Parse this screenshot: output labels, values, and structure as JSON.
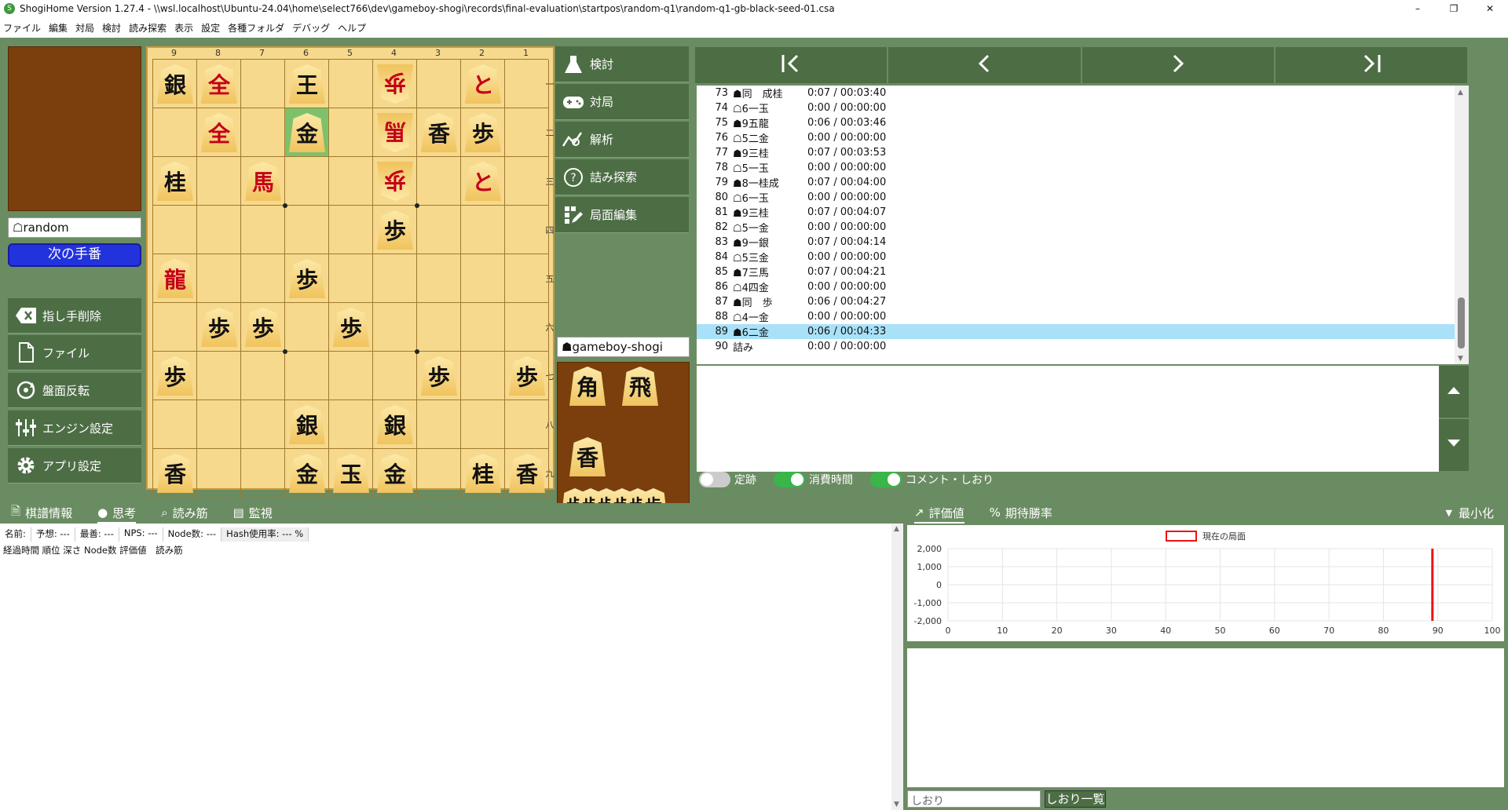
{
  "window": {
    "title": "ShogiHome Version 1.27.4 - \\\\wsl.localhost\\Ubuntu-24.04\\home\\select766\\dev\\gameboy-shogi\\records\\final-evaluation\\startpos\\random-q1\\random-q1-gb-black-seed-01.csa",
    "controls": [
      "–",
      "❐",
      "✕"
    ]
  },
  "menu": [
    "ファイル",
    "編集",
    "対局",
    "検討",
    "読み探索",
    "表示",
    "設定",
    "各種フォルダ",
    "デバッグ",
    "ヘルプ"
  ],
  "players": {
    "white": "☖random",
    "black": "☗gameboy-shogi",
    "next_turn": "次の手番"
  },
  "board": {
    "files": [
      "9",
      "8",
      "7",
      "6",
      "5",
      "4",
      "3",
      "2",
      "1"
    ],
    "ranks": [
      "一",
      "二",
      "三",
      "四",
      "五",
      "六",
      "七",
      "八",
      "九"
    ],
    "pieces": [
      {
        "f": 9,
        "r": 1,
        "c": "銀",
        "side": "b"
      },
      {
        "f": 8,
        "r": 1,
        "c": "全",
        "side": "b",
        "red": true
      },
      {
        "f": 6,
        "r": 1,
        "c": "王",
        "side": "b"
      },
      {
        "f": 4,
        "r": 1,
        "c": "歩",
        "side": "w",
        "red": true
      },
      {
        "f": 2,
        "r": 1,
        "c": "と",
        "side": "b",
        "red": true
      },
      {
        "f": 8,
        "r": 2,
        "c": "全",
        "side": "b",
        "red": true
      },
      {
        "f": 6,
        "r": 2,
        "c": "金",
        "side": "b",
        "hl": true
      },
      {
        "f": 4,
        "r": 2,
        "c": "馬",
        "side": "w",
        "red": true
      },
      {
        "f": 3,
        "r": 2,
        "c": "香",
        "side": "b"
      },
      {
        "f": 2,
        "r": 2,
        "c": "歩",
        "side": "b"
      },
      {
        "f": 9,
        "r": 3,
        "c": "桂",
        "side": "b"
      },
      {
        "f": 7,
        "r": 3,
        "c": "馬",
        "side": "b",
        "red": true
      },
      {
        "f": 4,
        "r": 3,
        "c": "歩",
        "side": "w",
        "red": true
      },
      {
        "f": 2,
        "r": 3,
        "c": "と",
        "side": "b",
        "red": true
      },
      {
        "f": 4,
        "r": 4,
        "c": "歩",
        "side": "b"
      },
      {
        "f": 9,
        "r": 5,
        "c": "龍",
        "side": "b",
        "red": true
      },
      {
        "f": 6,
        "r": 5,
        "c": "歩",
        "side": "b"
      },
      {
        "f": 8,
        "r": 6,
        "c": "歩",
        "side": "b"
      },
      {
        "f": 7,
        "r": 6,
        "c": "歩",
        "side": "b"
      },
      {
        "f": 5,
        "r": 6,
        "c": "歩",
        "side": "b"
      },
      {
        "f": 9,
        "r": 7,
        "c": "歩",
        "side": "b"
      },
      {
        "f": 3,
        "r": 7,
        "c": "歩",
        "side": "b"
      },
      {
        "f": 1,
        "r": 7,
        "c": "歩",
        "side": "b"
      },
      {
        "f": 6,
        "r": 8,
        "c": "銀",
        "side": "b"
      },
      {
        "f": 4,
        "r": 8,
        "c": "銀",
        "side": "b"
      },
      {
        "f": 9,
        "r": 9,
        "c": "香",
        "side": "b"
      },
      {
        "f": 6,
        "r": 9,
        "c": "金",
        "side": "b"
      },
      {
        "f": 5,
        "r": 9,
        "c": "玉",
        "side": "b"
      },
      {
        "f": 4,
        "r": 9,
        "c": "金",
        "side": "b"
      },
      {
        "f": 2,
        "r": 9,
        "c": "桂",
        "side": "b"
      },
      {
        "f": 1,
        "r": 9,
        "c": "香",
        "side": "b"
      }
    ],
    "hand_black": [
      "角",
      "飛",
      "香",
      "歩",
      "歩",
      "歩",
      "歩",
      "歩",
      "歩"
    ]
  },
  "left_buttons": [
    {
      "label": "指し手削除",
      "icon": "delete-icon"
    },
    {
      "label": "ファイル",
      "icon": "file-icon"
    },
    {
      "label": "盤面反転",
      "icon": "flip-icon"
    },
    {
      "label": "エンジン設定",
      "icon": "engine-settings-icon"
    },
    {
      "label": "アプリ設定",
      "icon": "gear-icon"
    }
  ],
  "right_buttons": [
    {
      "label": "検討",
      "icon": "flask-icon"
    },
    {
      "label": "対局",
      "icon": "gamepad-icon"
    },
    {
      "label": "解析",
      "icon": "analysis-icon"
    },
    {
      "label": "詰み探索",
      "icon": "mate-search-icon"
    },
    {
      "label": "局面編集",
      "icon": "edit-position-icon"
    }
  ],
  "nav": [
    "|<",
    "<",
    ">",
    ">|"
  ],
  "moves": [
    {
      "n": "73",
      "m": "☗同　成桂",
      "t": "0:07 / 00:03:40"
    },
    {
      "n": "74",
      "m": "☖6一玉",
      "t": "0:00 / 00:00:00"
    },
    {
      "n": "75",
      "m": "☗9五龍",
      "t": "0:06 / 00:03:46"
    },
    {
      "n": "76",
      "m": "☖5二金",
      "t": "0:00 / 00:00:00"
    },
    {
      "n": "77",
      "m": "☗9三桂",
      "t": "0:07 / 00:03:53"
    },
    {
      "n": "78",
      "m": "☖5一玉",
      "t": "0:00 / 00:00:00"
    },
    {
      "n": "79",
      "m": "☗8一桂成",
      "t": "0:07 / 00:04:00"
    },
    {
      "n": "80",
      "m": "☖6一玉",
      "t": "0:00 / 00:00:00"
    },
    {
      "n": "81",
      "m": "☗9三桂",
      "t": "0:07 / 00:04:07"
    },
    {
      "n": "82",
      "m": "☖5一金",
      "t": "0:00 / 00:00:00"
    },
    {
      "n": "83",
      "m": "☗9一銀",
      "t": "0:07 / 00:04:14"
    },
    {
      "n": "84",
      "m": "☖5三金",
      "t": "0:00 / 00:00:00"
    },
    {
      "n": "85",
      "m": "☗7三馬",
      "t": "0:07 / 00:04:21"
    },
    {
      "n": "86",
      "m": "☖4四金",
      "t": "0:00 / 00:00:00"
    },
    {
      "n": "87",
      "m": "☗同　歩",
      "t": "0:06 / 00:04:27"
    },
    {
      "n": "88",
      "m": "☖4一金",
      "t": "0:00 / 00:00:00"
    },
    {
      "n": "89",
      "m": "☗6二金",
      "t": "0:06 / 00:04:33",
      "selected": true
    },
    {
      "n": "90",
      "m": "詰み",
      "t": "0:00 / 00:00:00"
    }
  ],
  "toggles": [
    {
      "label": "定跡",
      "on": false
    },
    {
      "label": "消費時間",
      "on": true
    },
    {
      "label": "コメント・しおり",
      "on": true
    }
  ],
  "bottom_left": {
    "tabs": [
      "棋譜情報",
      "思考",
      "読み筋",
      "監視"
    ],
    "active_tab": 1,
    "header": [
      "名前:",
      "予想: ---",
      "最善: ---",
      "NPS: ---",
      "Node数: ---",
      "Hash使用率: --- %"
    ],
    "columns": "経過時間 順位 深さ Node数 評価値　読み筋"
  },
  "bottom_right": {
    "tabs": [
      "評価値",
      "期待勝率"
    ],
    "minimize": "最小化",
    "bookmark_placeholder": "しおり",
    "bookmark_button": "しおり一覧"
  },
  "chart_data": {
    "type": "line",
    "legend": "現在の局面",
    "x_ticks": [
      "0",
      "10",
      "20",
      "30",
      "40",
      "50",
      "60",
      "70",
      "80",
      "90",
      "100"
    ],
    "y_ticks": [
      "2,000",
      "1,000",
      "0",
      "-1,000",
      "-2,000"
    ],
    "xlim": [
      0,
      100
    ],
    "ylim": [
      -2000,
      2000
    ],
    "current_position_x": 89,
    "series": [],
    "colors": {
      "current": "#ee1111"
    }
  },
  "colors": {
    "accent": "#4d6e45",
    "background": "#6a8c62",
    "board": "#f6d98d",
    "hand": "#7a3f0c",
    "next_turn": "#2233dd",
    "selection": "#a9e1f8"
  }
}
